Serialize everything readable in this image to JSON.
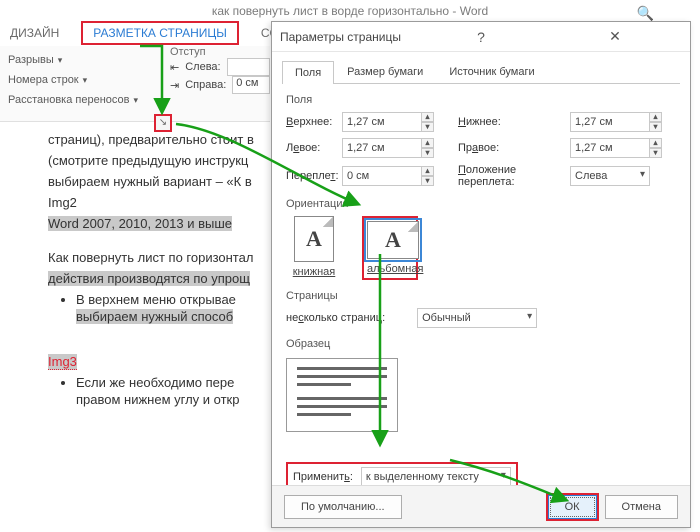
{
  "word": {
    "title": "как повернуть лист в ворде горизонтально - Word",
    "tabs": {
      "design": "ДИЗАЙН",
      "layout": "РАЗМЕТКА СТРАНИЦЫ",
      "refs": "ССЫЛК"
    },
    "ribbon": {
      "breaks": "Разрывы",
      "lineNumbers": "Номера строк",
      "hyphenation": "Расстановка переносов",
      "indentTitle": "Отступ",
      "left": "Слева:",
      "right": "Справа:",
      "leftVal": "",
      "rightVal": "0 см"
    },
    "doc": {
      "p1": "страниц), предварительно стоит в",
      "p2": "(смотрите предыдущую инструкц",
      "p3": "выбираем нужный вариант – «К в",
      "img2": "Img2",
      "hl1": "Word 2007, 2010, 2013 и выше",
      "p4": "Как повернуть лист по горизонтал",
      "p5": "действия производятся по упрощ",
      "li1": "В верхнем меню открывае",
      "li1b": "выбираем нужный способ",
      "img3": "Img3",
      "li2": "Если же необходимо пере",
      "li2b": "правом нижнем углу и откр"
    }
  },
  "dialog": {
    "title": "Параметры страницы",
    "tabs": {
      "fields": "Поля",
      "paper": "Размер бумаги",
      "source": "Источник бумаги"
    },
    "marginsTitle": "Поля",
    "topL": "Верхнее:",
    "topV": "1,27 см",
    "botL": "Нижнее:",
    "botV": "1,27 см",
    "leftL": "Левое:",
    "leftV": "1,27 см",
    "rightL": "Правое:",
    "rightV": "1,27 см",
    "gutterL": "Переплет:",
    "gutterV": "0 см",
    "gutterPosL": "Положение переплета:",
    "gutterPosV": "Слева",
    "orientTitle": "Ориентация",
    "portrait": "книжная",
    "landscape": "альбомная",
    "pagesTitle": "Страницы",
    "multiL": "несколько страниц:",
    "multiV": "Обычный",
    "previewTitle": "Образец",
    "applyL": "Применить:",
    "applyV": "к выделенному тексту",
    "defaults": "По умолчанию...",
    "ok": "ОК",
    "cancel": "Отмена"
  }
}
